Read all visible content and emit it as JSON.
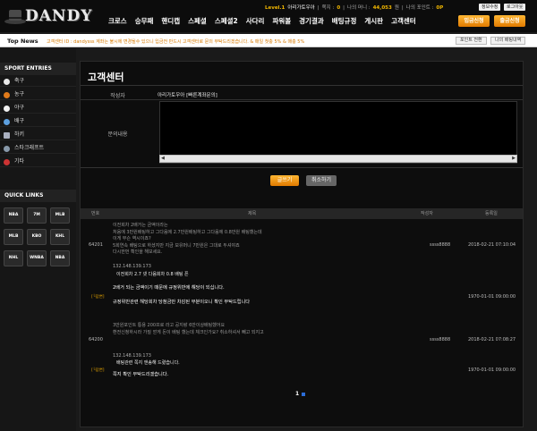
{
  "logo": {
    "text": "DANDY"
  },
  "header": {
    "level": "Level.1",
    "username": "아리가토우아",
    "msg_label": "쪽지 :",
    "msg_count": "0",
    "money_label": "나의 머니 :",
    "money_value": "44,053",
    "money_unit": "원",
    "point_label": "나의 포인트 :",
    "point_value": "0P",
    "btn_info": "정보수정",
    "btn_logout": "로그아웃",
    "nav": [
      "크로스",
      "승무패",
      "핸디캡",
      "스페셜",
      "스페셜2",
      "사다리",
      "파워볼",
      "경기결과",
      "배팅규정",
      "게시판",
      "고객센터"
    ],
    "deposit": "입금신청",
    "withdraw": "출금신청"
  },
  "news": {
    "label": "Top News",
    "text": "고객센터 ID : dandysss 계좌는 불시에 변경될수 있으니 입금전 반드시 고객센터로 문의 부탁드리겠습니다. & 매일 첫충 5% & 매충 5%",
    "btn_point": "포인트 전환",
    "btn_history": "나의 배팅내역"
  },
  "sidebar": {
    "sport_title": "SPORT ENTRIES",
    "sports": [
      {
        "label": "축구",
        "color": "#e8e8e8"
      },
      {
        "label": "농구",
        "color": "#e07a1a"
      },
      {
        "label": "야구",
        "color": "#f0f0f0"
      },
      {
        "label": "배구",
        "color": "#5da0e0"
      },
      {
        "label": "하키",
        "color": "#aab0c0"
      },
      {
        "label": "스타크래프트",
        "color": "#8899aa"
      },
      {
        "label": "기타",
        "color": "#cc3333"
      }
    ],
    "quick_title": "QUICK LINKS",
    "quick": [
      "NBA",
      "7M",
      "MLB",
      "MLB",
      "KBO",
      "KHL",
      "NHL",
      "WNBA",
      "NBA"
    ]
  },
  "page": {
    "title": "고객센터",
    "author_label": "작성자",
    "author_value": "아리가토우아",
    "subject_value": "[빠른계좌문의]",
    "content_label": "문의내용",
    "write_btn": "글쓰기",
    "cancel_btn": "취소하기",
    "col_num": "번호",
    "col_title": "제목",
    "col_author": "작성자",
    "col_date": "등록일"
  },
  "posts": [
    {
      "num": "64201",
      "lines": [
        "이전회차 2배거는 금액이라는",
        "처음에 3만원배팅하고 그다음에 2.7만원배팅하고 그다음에 0.8만원 배팅했는데",
        "이게 무슨 역시이죠?",
        "5회연속 배팅으로 하셨지만 지금 보유머니 7만원은 그대로 두셔야죠",
        "다시한번 확인을 해보세요."
      ],
      "ip": "132.148.139.173",
      "q2": "이전회차 2.7 넷 다음회차 0.8 배팅 픈",
      "nick": "ssss8888",
      "date": "2018-02-21 07:10:04",
      "reply_label": "[└답변]",
      "answer": [
        "2배거 되는 금액이기 때문에 규정위반에 해당이 되십니다.",
        "규정위반관련 해당회차 당첨금만 차감된 부분이오니 확인 부탁드립니다"
      ],
      "answer_date": "1970-01-01 09:00:00"
    },
    {
      "num": "64200",
      "lines": [
        "3만원포인트 통용 200프로 라고 공지랑 6만이상배팅했어요",
        "환전신청하시라 가질 얻게 돈이 배팅 했는데 체크인가요? 취소하셔서 빼고 되지고"
      ],
      "ip": "132.148.139.173",
      "q2": "배팅관련 쪽지 앤송해 드렸습니다.",
      "nick": "ssss8888",
      "date": "2018-02-21 07:08:27",
      "reply_label": "[└답변]",
      "answer": [
        "쪽지 확인 부탁드리겠습니다."
      ],
      "answer_date": "1970-01-01 09:00:00"
    }
  ],
  "pagination": {
    "current": "1"
  }
}
